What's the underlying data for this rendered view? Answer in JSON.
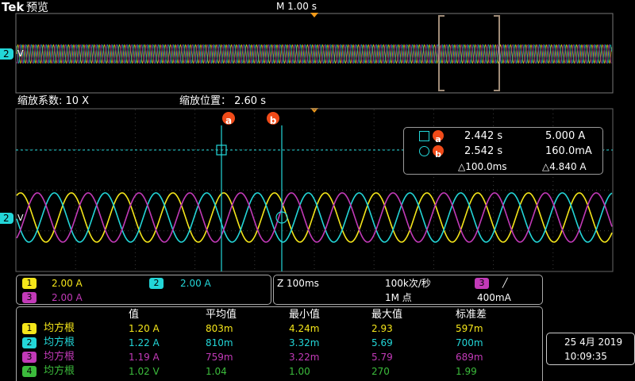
{
  "header": {
    "brand": "Tek",
    "mode": "预览",
    "timebase": "M 1.00 s"
  },
  "zoom": {
    "factor_label": "缩放系数: 10 X",
    "position_label": "缩放位置： 2.60 s"
  },
  "markers": {
    "ch_left": "2",
    "a": "a",
    "b": "b",
    "v_label": "V"
  },
  "cursor_readout": {
    "a_time": "2.442 s",
    "a_value": "5.000 A",
    "b_time": "2.542 s",
    "b_value": "160.0mA",
    "delta_time": "△100.0ms",
    "delta_value": "△4.840 A"
  },
  "channels": [
    {
      "id": "1",
      "scale": "2.00 A",
      "color": "#f5e61a"
    },
    {
      "id": "2",
      "scale": "2.00 A",
      "color": "#23d6d8"
    },
    {
      "id": "3",
      "scale": "2.00 A",
      "color": "#c23ab8"
    },
    {
      "id": "4",
      "color": "#3cbc3c"
    }
  ],
  "acquisition": {
    "horizontal": "Z 100ms",
    "rate": "100k次/秒",
    "points": "1M 点",
    "trigger_channel": "3",
    "trigger_slope": "╱",
    "trigger_level": "400mA"
  },
  "measurements": {
    "headers": [
      "值",
      "平均值",
      "最小值",
      "最大值",
      "标准差"
    ],
    "rows": [
      {
        "ch": "1",
        "name": "均方根",
        "values": [
          "1.20 A",
          "803m",
          "4.24m",
          "2.93",
          "597m"
        ]
      },
      {
        "ch": "2",
        "name": "均方根",
        "values": [
          "1.22 A",
          "810m",
          "3.32m",
          "5.69",
          "700m"
        ]
      },
      {
        "ch": "3",
        "name": "均方根",
        "values": [
          "1.19 A",
          "759m",
          "3.22m",
          "5.79",
          "689m"
        ]
      },
      {
        "ch": "4",
        "name": "均方根",
        "values": [
          "1.02 V",
          "1.04",
          "1.00",
          "270",
          "1.99"
        ]
      }
    ]
  },
  "datetime": {
    "date": "25 4月 2019",
    "time": "10:09:35"
  },
  "colors": {
    "trigger_marker": "#f29a1a",
    "cursor_badge": "#f04a18",
    "grid": "#3a3a3a"
  }
}
